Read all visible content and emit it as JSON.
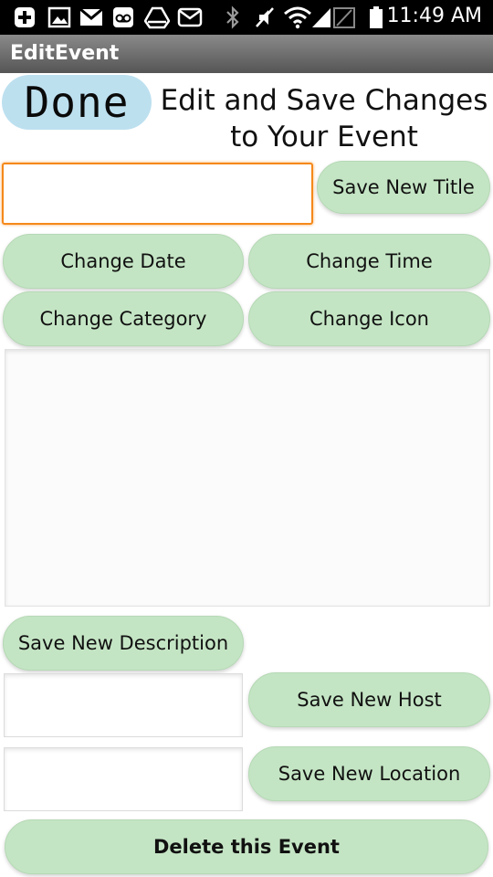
{
  "status_bar": {
    "time": "11:49 AM",
    "icons": [
      "add-notification-icon",
      "image-icon",
      "gmail-icon",
      "voicemail-icon",
      "drive-icon",
      "mail-icon",
      "bluetooth-icon",
      "mute-icon",
      "wifi-icon",
      "signal-icon",
      "battery-icon"
    ]
  },
  "app": {
    "title": "EditEvent"
  },
  "header": {
    "done_label": "Done",
    "heading": "Edit and Save Changes to Your Event"
  },
  "title_field": {
    "value": "",
    "save_label": "Save New Title"
  },
  "buttons": {
    "change_date": "Change Date",
    "change_time": "Change Time",
    "change_category": "Change Category",
    "change_icon": "Change Icon",
    "save_description": "Save New Description",
    "save_host": "Save New Host",
    "save_location": "Save New Location",
    "delete_event": "Delete this Event"
  },
  "description_field": {
    "value": ""
  },
  "host_field": {
    "value": ""
  },
  "location_field": {
    "value": ""
  },
  "colors": {
    "button_green": "#c4e5c4",
    "done_blue": "#bde0ef",
    "focus_orange": "#f5891a"
  }
}
